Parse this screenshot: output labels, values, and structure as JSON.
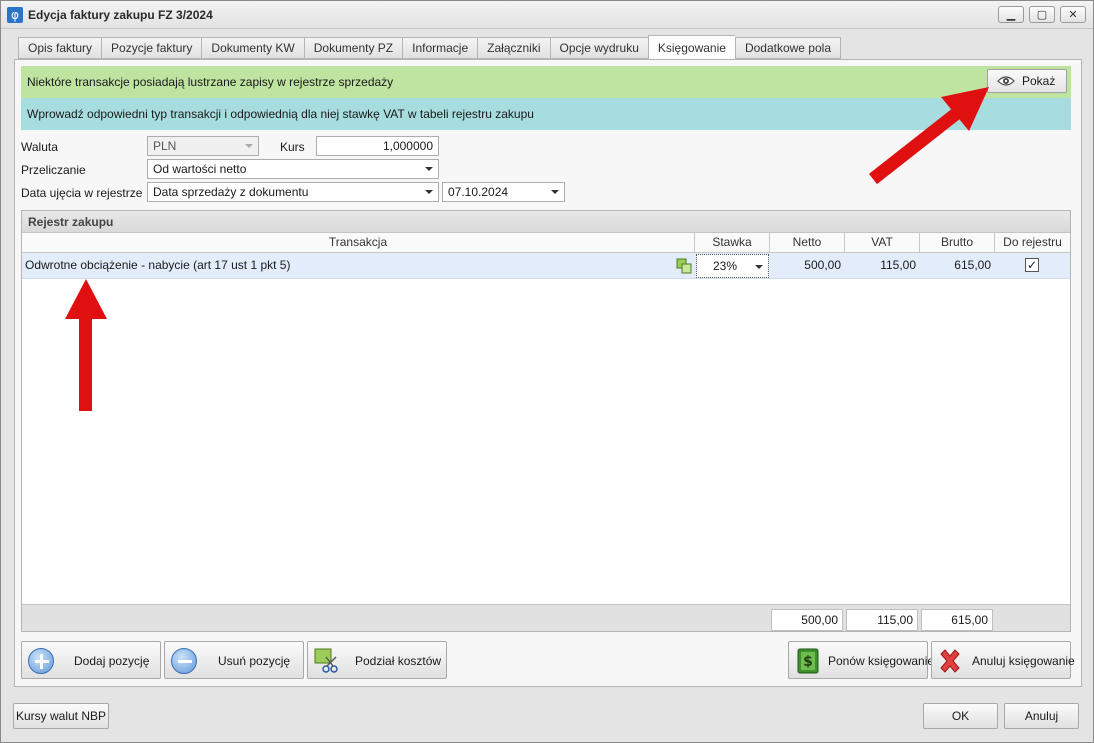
{
  "window": {
    "title": "Edycja faktury zakupu FZ 3/2024",
    "app_icon_glyph": "φ"
  },
  "window_controls": {
    "minimize": "▁",
    "maximize": "▢",
    "close": "✕"
  },
  "tabs": [
    {
      "label": "Opis faktury",
      "active": false
    },
    {
      "label": "Pozycje faktury",
      "active": false
    },
    {
      "label": "Dokumenty KW",
      "active": false
    },
    {
      "label": "Dokumenty PZ",
      "active": false
    },
    {
      "label": "Informacje",
      "active": false
    },
    {
      "label": "Załączniki",
      "active": false
    },
    {
      "label": "Opcje wydruku",
      "active": false
    },
    {
      "label": "Księgowanie",
      "active": true
    },
    {
      "label": "Dodatkowe pola",
      "active": false
    }
  ],
  "banners": {
    "mirror_notice": "Niektóre transakcje posiadają lustrzane zapisy w rejestrze sprzedaży",
    "show_button": "Pokaż",
    "instruction": "Wprowadź odpowiedni typ transakcji i odpowiednią dla niej stawkę VAT w tabeli rejestru zakupu"
  },
  "form": {
    "currency_label": "Waluta",
    "currency_value": "PLN",
    "rate_label": "Kurs",
    "rate_value": "1,000000",
    "recalc_label": "Przeliczanie",
    "recalc_value": "Od wartości netto",
    "register_date_label": "Data ujęcia w rejestrze",
    "register_date_mode": "Data sprzedaży z dokumentu",
    "register_date_value": "07.10.2024"
  },
  "register": {
    "title": "Rejestr zakupu",
    "columns": {
      "transaction": "Transakcja",
      "rate": "Stawka",
      "net": "Netto",
      "vat": "VAT",
      "gross": "Brutto",
      "to_register": "Do rejestru"
    },
    "rows": [
      {
        "transaction": "Odwrotne obciążenie - nabycie (art 17 ust 1 pkt 5)",
        "rate": "23%",
        "net": "500,00",
        "vat": "115,00",
        "gross": "615,00",
        "to_register": true,
        "checkmark": "✓"
      }
    ],
    "totals": {
      "net": "500,00",
      "vat": "115,00",
      "gross": "615,00"
    }
  },
  "actions": {
    "add_item": "Dodaj pozycję",
    "remove_item": "Usuń pozycję",
    "cost_split": "Podział kosztów",
    "repost": "Ponów księgowanie",
    "cancel_posting": "Anuluj księgowanie"
  },
  "footer": {
    "nbp_rates": "Kursy walut NBP",
    "ok": "OK",
    "cancel": "Anuluj"
  },
  "colors": {
    "green_banner": "#bfe3a0",
    "blue_banner": "#a8dde0",
    "selected_row": "#e2ecfb",
    "annotation_arrow": "#e01010"
  }
}
